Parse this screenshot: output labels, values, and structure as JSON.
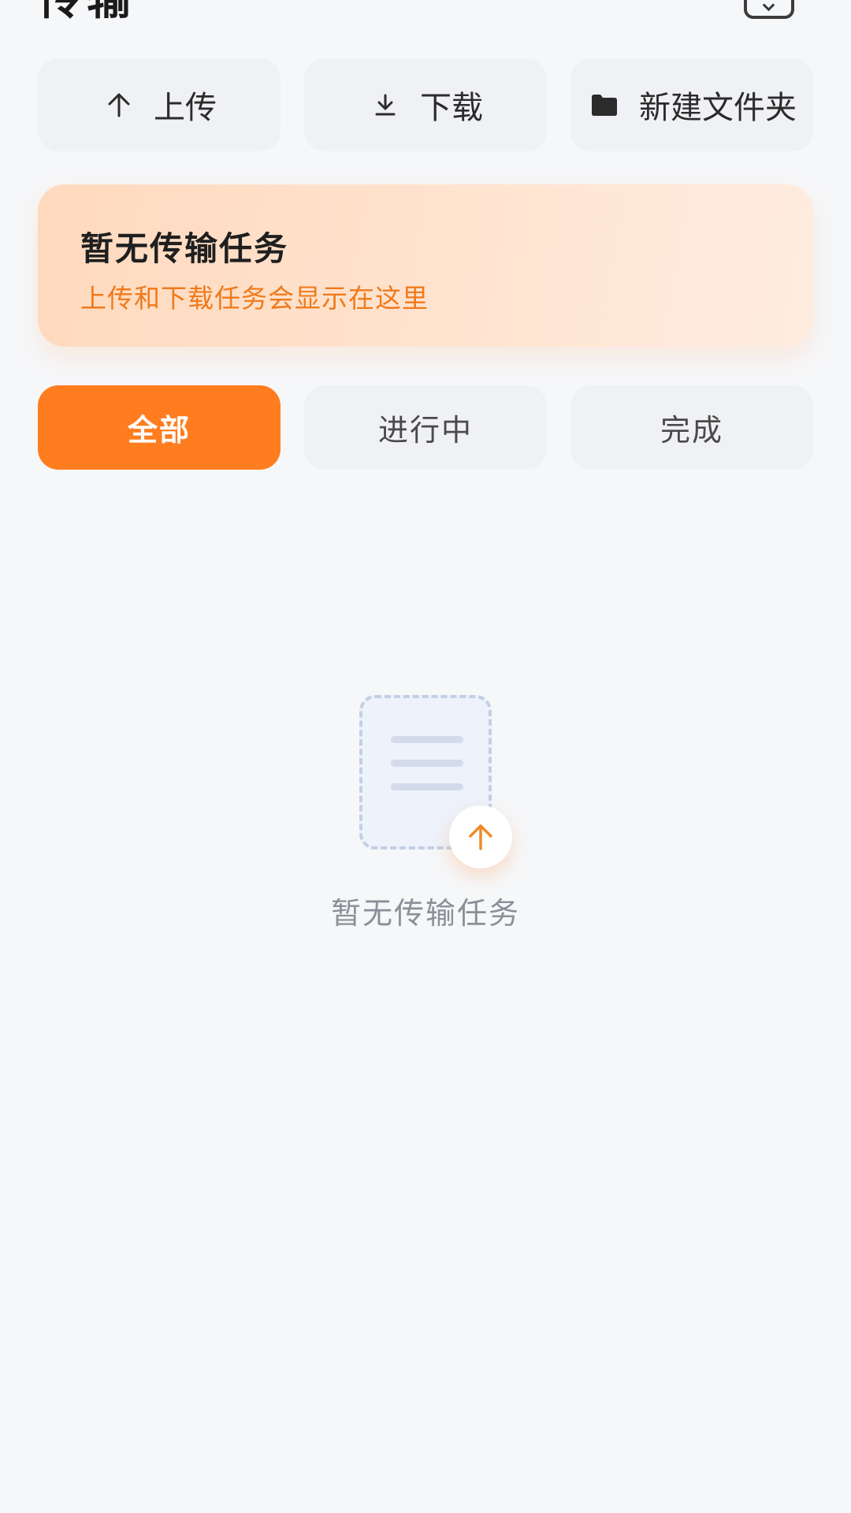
{
  "header": {
    "title": "传输"
  },
  "actions": {
    "upload": "上传",
    "download": "下载",
    "new_folder": "新建文件夹"
  },
  "banner": {
    "title": "暂无传输任务",
    "subtitle": "上传和下载任务会显示在这里"
  },
  "tabs": [
    {
      "label": "全部",
      "active": true
    },
    {
      "label": "进行中",
      "active": false
    },
    {
      "label": "完成",
      "active": false
    }
  ],
  "empty_state": {
    "message": "暂无传输任务"
  },
  "colors": {
    "accent": "#ff7d1f",
    "banner_text": "#ef7a1c",
    "background": "#f6f7f9"
  },
  "icons": {
    "upload": "arrow-up-icon",
    "download": "download-icon",
    "new_folder": "folder-icon",
    "header_action": "box-check-icon",
    "badge": "arrow-up-icon"
  }
}
